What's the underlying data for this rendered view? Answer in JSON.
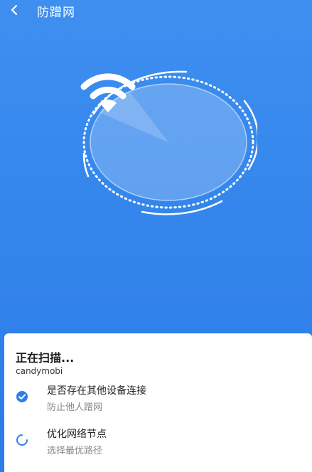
{
  "header": {
    "title": "防蹭网",
    "back_icon": "chevron-left-icon"
  },
  "scanner": {
    "icon": "wifi-icon"
  },
  "status": {
    "title": "正在扫描...",
    "network": "candymobi"
  },
  "tasks": [
    {
      "title": "是否存在其他设备连接",
      "subtitle": "防止他人蹭网",
      "state": "done",
      "icon": "check-circle-icon"
    },
    {
      "title": "优化网络节点",
      "subtitle": "选择最优路径",
      "state": "loading",
      "icon": "loading-spinner-icon"
    }
  ],
  "colors": {
    "background": "#3486ec",
    "accent": "#2f7ee8",
    "card": "#ffffff"
  }
}
